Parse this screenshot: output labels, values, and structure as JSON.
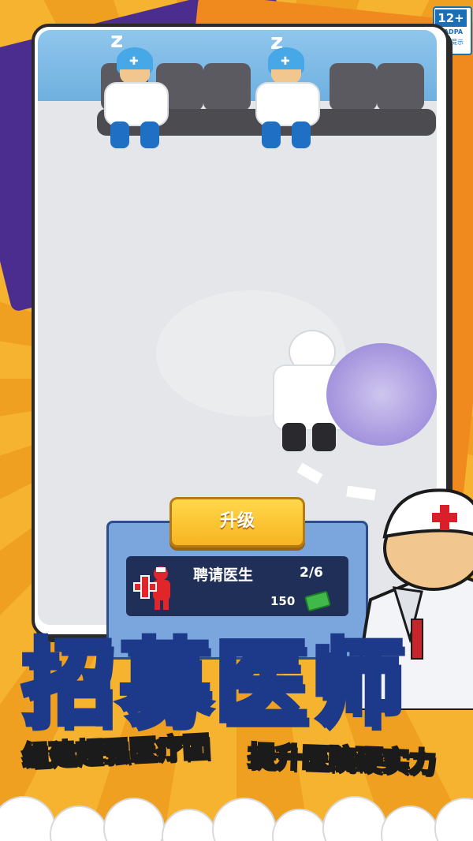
{
  "rating": {
    "age": "12+",
    "org": "CADPA",
    "tip": "适龄提示"
  },
  "scene": {
    "sleep_marks": [
      "z",
      "z"
    ]
  },
  "panel": {
    "upgrade_label": "升级",
    "hire_title": "聘请医生",
    "hire_count": "2/6",
    "hire_price": "150"
  },
  "promo": {
    "title": "招募医师",
    "subtitle_left": "组建超强医疗团",
    "subtitle_right": "提升医院硬实力"
  },
  "colors": {
    "brand_orange": "#f3a424",
    "title_stroke": "#1d3a8a",
    "upgrade_yellow": "#f7b421",
    "panel_blue": "#7aa6dd"
  }
}
